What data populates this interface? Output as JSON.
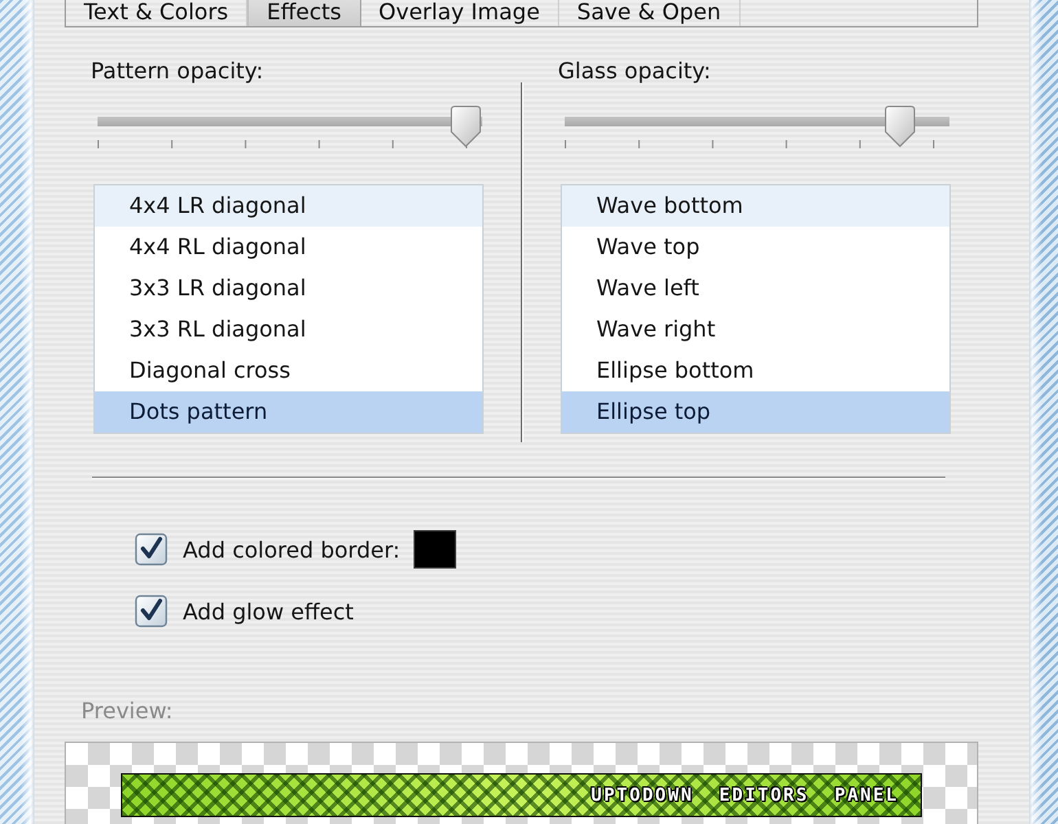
{
  "tabs": [
    {
      "label": "Text & Colors",
      "selected": false
    },
    {
      "label": "Effects",
      "selected": true
    },
    {
      "label": "Overlay Image",
      "selected": false
    },
    {
      "label": "Save & Open",
      "selected": false
    }
  ],
  "columns": [
    {
      "label": "Pattern opacity:",
      "level": 1,
      "items": [
        {
          "label": "4x4 LR diagonal",
          "selected": false
        },
        {
          "label": "4x4 RL diagonal",
          "selected": false
        },
        {
          "label": "3x3 LR diagonal",
          "selected": false
        },
        {
          "label": "3x3 RL diagonal",
          "selected": false
        },
        {
          "label": "Diagonal cross",
          "selected": false
        },
        {
          "label": "Dots pattern",
          "selected": true
        }
      ]
    },
    {
      "label": "Glass opacity:",
      "level": 0.91,
      "items": [
        {
          "label": "Wave bottom",
          "selected": false
        },
        {
          "label": "Wave top",
          "selected": false
        },
        {
          "label": "Wave left",
          "selected": false
        },
        {
          "label": "Wave right",
          "selected": false
        },
        {
          "label": "Ellipse bottom",
          "selected": false
        },
        {
          "label": "Ellipse top",
          "selected": true
        }
      ]
    }
  ],
  "options": [
    {
      "label": "Add colored border:",
      "checked": true,
      "color": "#000000"
    },
    {
      "label": "Add glow effect",
      "checked": true
    }
  ],
  "preview": {
    "label": "Preview:",
    "banner_text": "UPTODOWN  EDITORS  PANEL"
  }
}
